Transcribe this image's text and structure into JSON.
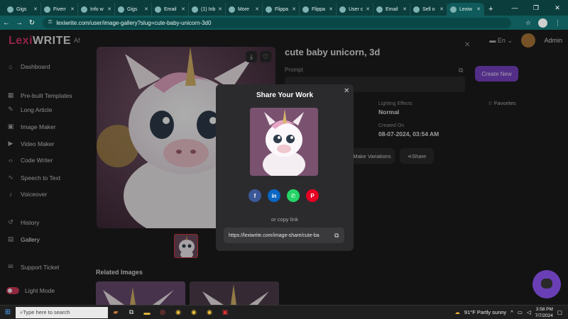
{
  "browser": {
    "tabs": [
      {
        "label": "Gigs",
        "active": false
      },
      {
        "label": "Fiverr",
        "active": false
      },
      {
        "label": "Info w",
        "active": false
      },
      {
        "label": "Gigs",
        "active": false
      },
      {
        "label": "Email",
        "active": false
      },
      {
        "label": "(1) Inb",
        "active": false
      },
      {
        "label": "More",
        "active": false
      },
      {
        "label": "Flippa",
        "active": false
      },
      {
        "label": "Flippa",
        "active": false
      },
      {
        "label": "User c",
        "active": false
      },
      {
        "label": "Email",
        "active": false
      },
      {
        "label": "Sell o",
        "active": false
      },
      {
        "label": "Lexiw",
        "active": true
      }
    ],
    "url": "lexiwrite.com/user/image-gallery?slug=cute-baby-unicorn-3d0"
  },
  "app": {
    "logo_part1": "Lexi",
    "logo_part2": "WRITE",
    "header_fragment": "Af",
    "language": "En",
    "user_name": "Admin",
    "sidebar": [
      {
        "label": "Dashboard",
        "icon": "home-icon"
      },
      {
        "label": "Pre-built Templates",
        "icon": "grid-icon"
      },
      {
        "label": "Long Article",
        "icon": "pen-icon"
      },
      {
        "label": "Image Maker",
        "icon": "image-icon"
      },
      {
        "label": "Video Maker",
        "icon": "video-icon"
      },
      {
        "label": "Code Writer",
        "icon": "code-icon"
      },
      {
        "label": "Speech to Text",
        "icon": "wave-icon"
      },
      {
        "label": "Voiceover",
        "icon": "mic-icon"
      },
      {
        "label": "History",
        "icon": "history-icon"
      },
      {
        "label": "Gallery",
        "icon": "gallery-icon"
      },
      {
        "label": "Support Ticket",
        "icon": "ticket-icon"
      }
    ],
    "light_mode_label": "Light Mode"
  },
  "detail": {
    "title": "cute baby unicorn, 3d",
    "prompt_label": "Prompt",
    "create_new_label": "Create New",
    "favorites_label": "Favorites",
    "lighting_label": "Lighting Effects",
    "lighting_value": "Normal",
    "created_label": "Created On",
    "created_value": "08-07-2024, 03:54 AM",
    "make_variations_label": "Make Variations",
    "share_label": "Share",
    "related_label": "Related Images"
  },
  "modal": {
    "title": "Share Your Work",
    "social": [
      {
        "glyph": "f",
        "name": "facebook",
        "color": "#3b5998"
      },
      {
        "glyph": "in",
        "name": "linkedin",
        "color": "#0a66c2"
      },
      {
        "glyph": "✆",
        "name": "whatsapp",
        "color": "#25d366"
      },
      {
        "glyph": "P",
        "name": "pinterest",
        "color": "#e60023"
      }
    ],
    "or_copy": "or copy link",
    "link": "https://lexiwrite.com/image-share/cute-ba"
  },
  "taskbar": {
    "search_placeholder": "Type here to search",
    "weather": "91°F  Partly sunny",
    "time": "3:58 PM",
    "date": "7/7/2024"
  }
}
